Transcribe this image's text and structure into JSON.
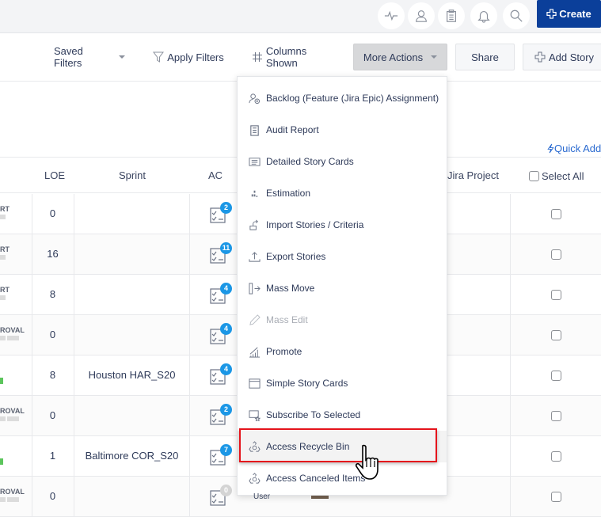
{
  "topbar": {
    "icons": [
      "activity-icon",
      "user-icon",
      "clipboard-icon",
      "bell-icon",
      "search-icon"
    ],
    "create_label": "Create"
  },
  "toolbar": {
    "saved_filters": "Saved Filters",
    "apply_filters": "Apply Filters",
    "columns_shown": "Columns Shown",
    "more_actions": "More Actions",
    "share": "Share",
    "add_story": "Add Story"
  },
  "quick_add": "Quick Add",
  "table": {
    "headers": {
      "loe": "LOE",
      "sprint": "Sprint",
      "ac": "AC",
      "jira_project": "Jira Project",
      "select_all": "Select All"
    },
    "rows": [
      {
        "status": "RT",
        "loe": "0",
        "sprint": "",
        "ac": "2"
      },
      {
        "status": "RT",
        "loe": "16",
        "sprint": "",
        "ac": "11"
      },
      {
        "status": "RT",
        "loe": "8",
        "sprint": "",
        "ac": "4"
      },
      {
        "status": "ROVAL",
        "loe": "0",
        "sprint": "",
        "ac": "4"
      },
      {
        "status": "",
        "loe": "8",
        "sprint": "Houston HAR_S20",
        "ac": "4"
      },
      {
        "status": "ROVAL",
        "loe": "0",
        "sprint": "",
        "ac": "2"
      },
      {
        "status": "",
        "loe": "1",
        "sprint": "Baltimore COR_S20",
        "ac": "7"
      },
      {
        "status": "ROVAL",
        "loe": "0",
        "sprint": "",
        "ac": "0"
      }
    ],
    "partial_user_label": "User"
  },
  "menu": {
    "items": [
      {
        "label": "Backlog (Feature (Jira Epic) Assignment)",
        "icon": "user-add-icon",
        "disabled": false
      },
      {
        "label": "Audit Report",
        "icon": "clipboard-icon",
        "disabled": false
      },
      {
        "label": "Detailed Story Cards",
        "icon": "document-icon",
        "disabled": false
      },
      {
        "label": "Estimation",
        "icon": "estimation-icon",
        "disabled": false
      },
      {
        "label": "Import Stories / Criteria",
        "icon": "import-icon",
        "disabled": false
      },
      {
        "label": "Export Stories",
        "icon": "export-icon",
        "disabled": false
      },
      {
        "label": "Mass Move",
        "icon": "move-icon",
        "disabled": false
      },
      {
        "label": "Mass Edit",
        "icon": "pencil-icon",
        "disabled": true
      },
      {
        "label": "Promote",
        "icon": "promote-icon",
        "disabled": false
      },
      {
        "label": "Simple Story Cards",
        "icon": "card-icon",
        "disabled": false
      },
      {
        "label": "Subscribe To Selected",
        "icon": "subscribe-icon",
        "disabled": false
      },
      {
        "label": "Access Recycle Bin",
        "icon": "recycle-icon",
        "disabled": false,
        "highlighted": true
      },
      {
        "label": "Access Canceled Items",
        "icon": "recycle-icon",
        "disabled": false
      }
    ]
  },
  "colors": {
    "create_button": "#0b3f9a",
    "badge": "#1b97e6",
    "highlight_border": "#e5141c",
    "link": "#2a6ad0"
  }
}
